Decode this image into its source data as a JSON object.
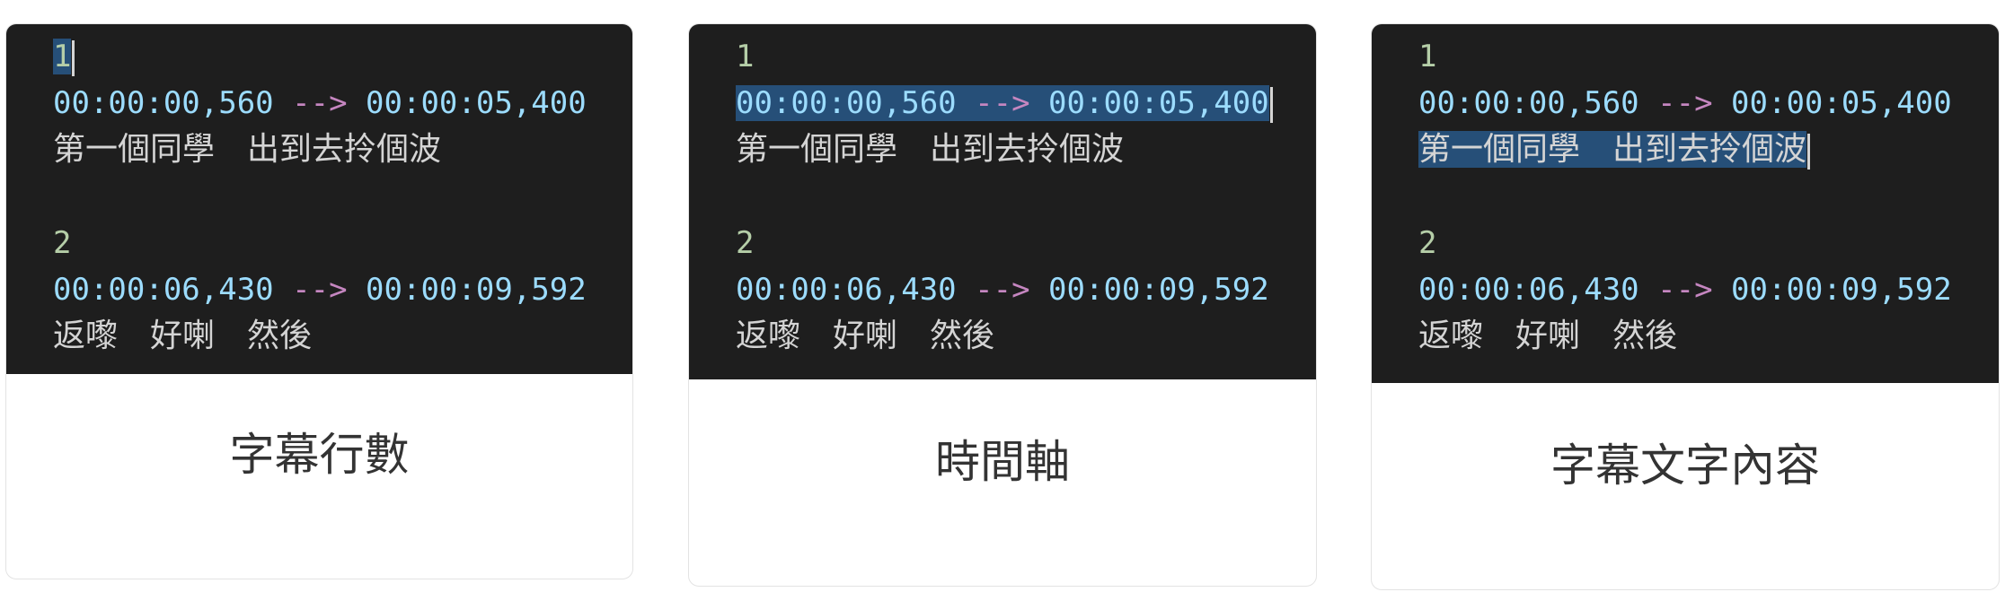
{
  "panels": [
    {
      "caption": "字幕行數",
      "entries": [
        {
          "index": "1",
          "start": "00:00:00,560",
          "arrow": "-->",
          "end": "00:00:05,400",
          "text": "第一個同學　出到去拎個波"
        },
        {
          "index": "2",
          "start": "00:00:06,430",
          "arrow": "-->",
          "end": "00:00:09,592",
          "text": "返嚟　好喇　然後"
        }
      ]
    },
    {
      "caption": "時間軸",
      "entries": [
        {
          "index": "1",
          "start": "00:00:00,560",
          "arrow": "-->",
          "end": "00:00:05,400",
          "text": "第一個同學　出到去拎個波"
        },
        {
          "index": "2",
          "start": "00:00:06,430",
          "arrow": "-->",
          "end": "00:00:09,592",
          "text": "返嚟　好喇　然後"
        }
      ]
    },
    {
      "caption": "字幕文字內容",
      "entries": [
        {
          "index": "1",
          "start": "00:00:00,560",
          "arrow": "-->",
          "end": "00:00:05,400",
          "text": "第一個同學　出到去拎個波"
        },
        {
          "index": "2",
          "start": "00:00:06,430",
          "arrow": "-->",
          "end": "00:00:09,592",
          "text": "返嚟　好喇　然後"
        }
      ]
    }
  ],
  "colors": {
    "editor_bg": "#1e1e1e",
    "number": "#b5cea8",
    "timecode": "#9cdcfe",
    "arrow": "#c586c0",
    "subtitle_text": "#d4d4d4",
    "selection": "#264f78"
  }
}
